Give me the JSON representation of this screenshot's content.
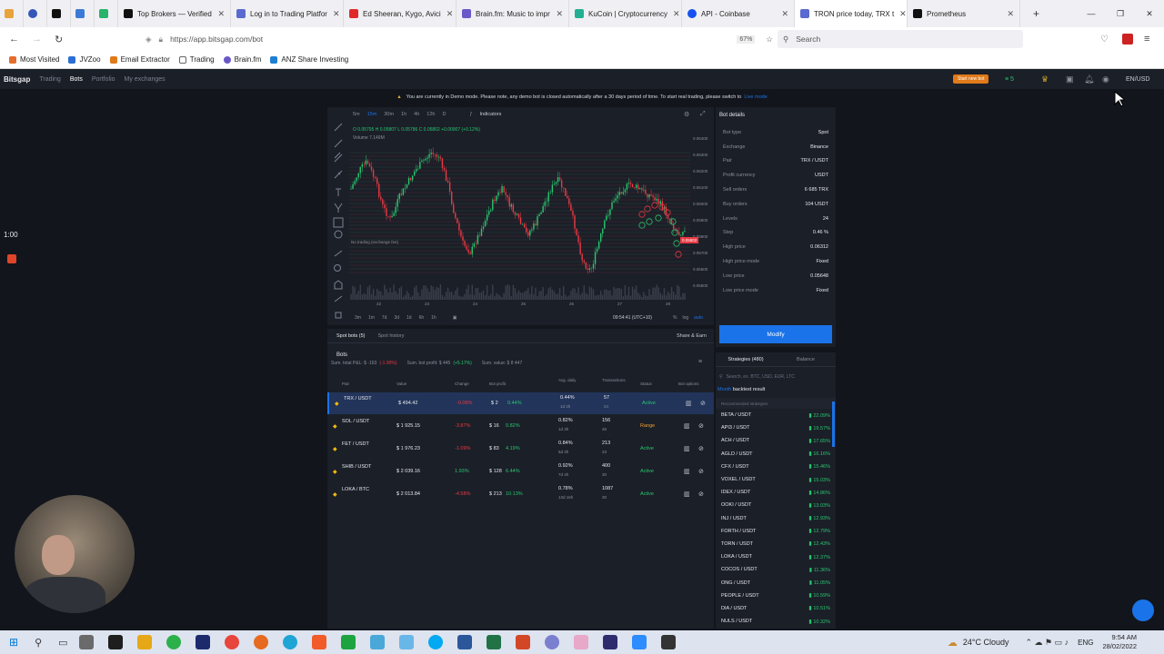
{
  "browser": {
    "tabs": [
      "Top Brokers — Verified",
      "Log in to Trading Platfor",
      "Ed Sheeran, Kygo, Avici",
      "Brain.fm: Music to impr",
      "KuCoin | Cryptocurrency",
      "API - Coinbase",
      "TRON price today, TRX t",
      "Prometheus"
    ],
    "url": "https://app.bitsgap.com/bot",
    "zoom": "67%",
    "search_placeholder": "Search",
    "bookmarks": [
      "Most Visited",
      "JVZoo",
      "Email Extractor",
      "Trading",
      "Brain.fm",
      "ANZ Share Investing"
    ]
  },
  "app": {
    "brand": "Bitsgap",
    "nav": [
      "Trading",
      "Bots",
      "Portfolio",
      "My exchanges"
    ],
    "active_nav": "Bots",
    "start_bot": "Start new bot",
    "notif_count": "5",
    "lang": "EN/USD",
    "demo_notice": "You are currently in Demo mode. Please note, any demo bot is closed automatically after a 30 days period of time. To start real trading, please switch to",
    "demo_link": "Live mode",
    "timer": "1:00"
  },
  "chart": {
    "timeframes": [
      "5m",
      "15m",
      "30m",
      "1h",
      "4h",
      "12h",
      "D"
    ],
    "active_tf": "15m",
    "indicators": "Indicators",
    "ohlc": "O 0.05795  H 0.05807  L 0.05786  C 0.05802  +0.00007 (+0.12%)",
    "volume": "Volume  7.149M",
    "no_trading": "No trading (exchange fee)",
    "price_ticks": [
      "0.06400",
      "0.06300",
      "0.06200",
      "0.06100",
      "0.06000",
      "0.05900",
      "0.05800",
      "0.05700",
      "0.05600",
      "0.05500"
    ],
    "date_ticks": [
      "22",
      "23",
      "24",
      "25",
      "26",
      "27",
      "28"
    ],
    "current_price": "0.05802",
    "ranges": [
      "3m",
      "1m",
      "7d",
      "3d",
      "1d",
      "6h",
      "1h"
    ],
    "clock": "09:54:41 (UTC+10)",
    "scale": [
      "%",
      "log",
      "auto"
    ]
  },
  "details": {
    "title": "Bot details",
    "rows": [
      {
        "k": "Bot type",
        "v": "Spot"
      },
      {
        "k": "Exchange",
        "v": "Binance"
      },
      {
        "k": "Pair",
        "v": "TRX / USDT"
      },
      {
        "k": "Profit currency",
        "v": "USDT"
      },
      {
        "k": "Sell orders",
        "v": "6 685 TRX"
      },
      {
        "k": "Buy orders",
        "v": "104 USDT"
      },
      {
        "k": "Levels",
        "v": "24"
      },
      {
        "k": "Step",
        "v": "0.46 %"
      },
      {
        "k": "High price",
        "v": "0.06312"
      },
      {
        "k": "High price mode",
        "v": "Fixed"
      },
      {
        "k": "Low price",
        "v": "0.05648"
      },
      {
        "k": "Low price mode",
        "v": "Fixed"
      }
    ],
    "modify": "Modify"
  },
  "bots": {
    "tabs": [
      "Spot bots (5)",
      "Spot history"
    ],
    "share": "Share & Earn",
    "heading": "Bots",
    "summary_pnl": "Sum. total P&L: $ -163",
    "summary_pnl_pct": "(-1.90%)",
    "summary_profit": "Sum. bot profit: $ 445",
    "summary_profit_pct": "(+5.17%)",
    "summary_value": "Sum. value: $ 8 447",
    "headers": [
      "Pair",
      "Value",
      "Change",
      "Bot profit",
      "Avg. daily",
      "Transactions",
      "Status",
      "Bot options"
    ],
    "rows": [
      {
        "pair": "TRX / USDT",
        "value": "$ 494.42",
        "change": "-0.06%",
        "profit": "$ 2",
        "profit_pct": "0.44%",
        "daily": "0.44%",
        "age": "1d 2h",
        "tx": "57",
        "lv": "24",
        "status": "Active"
      },
      {
        "pair": "SOL / USDT",
        "value": "$ 1 925.15",
        "change": "-3.87%",
        "profit": "$ 16",
        "profit_pct": "0.82%",
        "daily": "0.82%",
        "age": "1d 3h",
        "tx": "156",
        "lv": "26",
        "status": "Range"
      },
      {
        "pair": "FET / USDT",
        "value": "$ 1 976.23",
        "change": "-1.09%",
        "profit": "$ 83",
        "profit_pct": "4.19%",
        "daily": "0.84%",
        "age": "5d 3h",
        "tx": "213",
        "lv": "23",
        "status": "Active"
      },
      {
        "pair": "SHIB / USDT",
        "value": "$ 2 039.16",
        "change": "1.93%",
        "profit": "$ 128",
        "profit_pct": "6.44%",
        "daily": "0.92%",
        "age": "7d 4h",
        "tx": "400",
        "lv": "30",
        "status": "Active"
      },
      {
        "pair": "LOKA / BTC",
        "value": "$ 2 013.84",
        "change": "-4.58%",
        "profit": "$ 213",
        "profit_pct": "10.13%",
        "daily": "0.78%",
        "age": "13d 16h",
        "tx": "1087",
        "lv": "30",
        "status": "Active"
      }
    ]
  },
  "strategies": {
    "tabs": [
      "Strategies (480)",
      "Balance"
    ],
    "search_placeholder": "Search, ex. BTC, USD, EUR, LTC",
    "period": "Month",
    "backtest": "backtest result",
    "recommended": "Recommended strategies",
    "items": [
      {
        "p": "BETA / USDT",
        "v": "22.09%"
      },
      {
        "p": "API3 / USDT",
        "v": "19.57%"
      },
      {
        "p": "ACH / USDT",
        "v": "17.65%"
      },
      {
        "p": "AGLD / USDT",
        "v": "16.16%"
      },
      {
        "p": "CFX / USDT",
        "v": "15.46%"
      },
      {
        "p": "VOXEL / USDT",
        "v": "15.03%"
      },
      {
        "p": "IDEX / USDT",
        "v": "14.86%"
      },
      {
        "p": "OOKI / USDT",
        "v": "13.03%"
      },
      {
        "p": "INJ / USDT",
        "v": "12.93%"
      },
      {
        "p": "FORTH / USDT",
        "v": "12.79%"
      },
      {
        "p": "TORN / USDT",
        "v": "12.43%"
      },
      {
        "p": "LOKA / USDT",
        "v": "12.37%"
      },
      {
        "p": "COCOS / USDT",
        "v": "11.36%"
      },
      {
        "p": "ONG / USDT",
        "v": "11.05%"
      },
      {
        "p": "PEOPLE / USDT",
        "v": "10.59%"
      },
      {
        "p": "DIA / USDT",
        "v": "10.51%"
      },
      {
        "p": "NULS / USDT",
        "v": "10.32%"
      }
    ]
  },
  "taskbar": {
    "weather": "24°C  Cloudy",
    "lang": "ENG",
    "time": "9:54 AM",
    "date": "28/02/2022"
  }
}
